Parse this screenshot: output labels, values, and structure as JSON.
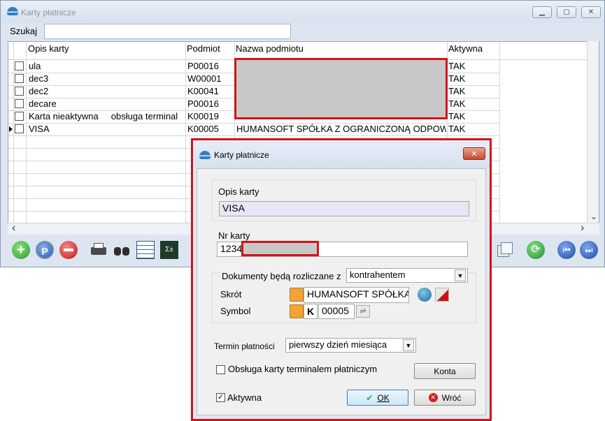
{
  "main": {
    "title": "Karty płatnicze",
    "search_label": "Szukaj",
    "search_value": "",
    "columns": [
      "Opis karty",
      "Podmiot",
      "Nazwa podmiotu",
      "Aktywna"
    ],
    "rows": [
      {
        "opis": "ula",
        "podmiot": "P00016",
        "nazwa": "",
        "aktywna": "TAK"
      },
      {
        "opis": "dec3",
        "podmiot": "W00001",
        "nazwa": "",
        "aktywna": "TAK"
      },
      {
        "opis": "dec2",
        "podmiot": "K00041",
        "nazwa": "",
        "aktywna": "TAK"
      },
      {
        "opis": "decare",
        "podmiot": "P00016",
        "nazwa": "",
        "aktywna": "TAK"
      },
      {
        "opis": "Karta nieaktywna     obsługa terminal",
        "podmiot": "K00019",
        "nazwa": "",
        "aktywna": "TAK"
      },
      {
        "opis": "VISA",
        "podmiot": "K00005",
        "nazwa": "HUMANSOFT SPÓŁKA Z OGRANICZONĄ ODPOWIEDZ",
        "aktywna": "TAK"
      }
    ],
    "scroll_left": "‹",
    "scroll_right": "›",
    "scroll_down": "⌄"
  },
  "dialog": {
    "title": "Karty płatnicze",
    "close": "✕",
    "opis_label": "Opis karty",
    "opis_value": "VISA",
    "nr_label": "Nr karty",
    "nr_value": "1234",
    "dokumenty_label": "Dokumenty będą rozliczane z",
    "dokumenty_value": "kontrahentem",
    "skrot_label": "Skrót",
    "skrot_value": "HUMANSOFT SPÓŁKA",
    "symbol_label": "Symbol",
    "symbol_type": "K",
    "symbol_value": "00005",
    "termin_label": "Termin płatności",
    "termin_value": "pierwszy dzień miesiąca",
    "obsluga_label": "Obsługa karty terminalem płatniczym",
    "obsluga_checked": false,
    "konta_button": "Konta",
    "aktywna_label": "Aktywna",
    "aktywna_checked": true,
    "ok_button": "OK",
    "wroc_button": "Wróć"
  },
  "colors": {
    "accent_red": "#d0141a",
    "redaction_gray": "#c8c8c8",
    "field_lavender": "#e6e6f6"
  }
}
